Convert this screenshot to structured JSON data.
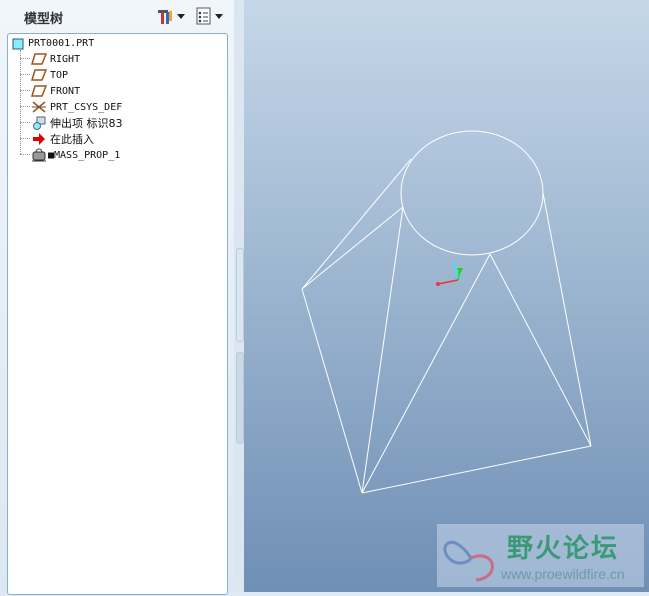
{
  "panel": {
    "title": "模型树"
  },
  "toolbar": {
    "settings_icon": "tools-icon",
    "show_icon": "list-icon"
  },
  "tree": [
    {
      "label": "PRT0001.PRT",
      "icon": "part-icon"
    },
    {
      "label": "RIGHT",
      "icon": "datum-plane-icon"
    },
    {
      "label": "TOP",
      "icon": "datum-plane-icon"
    },
    {
      "label": "FRONT",
      "icon": "datum-plane-icon"
    },
    {
      "label": "PRT_CSYS_DEF",
      "icon": "csys-icon"
    },
    {
      "label": "伸出项 标识83",
      "icon": "protrusion-icon"
    },
    {
      "label": "在此插入",
      "icon": "insert-here-arrow-icon"
    },
    {
      "label": "■MASS_PROP_1",
      "icon": "mass-prop-icon"
    }
  ],
  "watermark": {
    "title": "野火论坛",
    "url": "www.proewildfire.cn"
  },
  "colors": {
    "accent": "#8ab0cc",
    "insert": "#e00000",
    "plane": "#a0521d"
  }
}
